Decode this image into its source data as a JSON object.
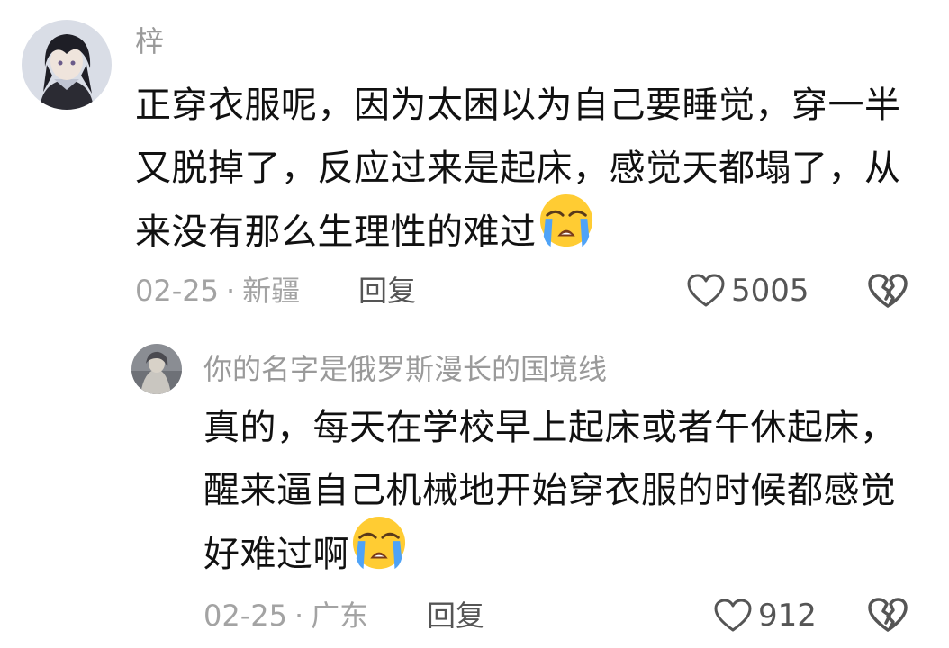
{
  "comments": [
    {
      "username": "梓",
      "body_lines": [
        "正穿衣服呢，因为太困以为自己要睡觉，穿一半",
        "又脱掉了，反应过来是起床，感觉天都塌了，从",
        "来没有那么生理性的难过"
      ],
      "date": "02-25",
      "location": "新疆",
      "reply_label": "回复",
      "like_count": "5005"
    },
    {
      "username": "你的名字是俄罗斯漫长的国境线",
      "body_lines": [
        "真的，每天在学校早上起床或者午休起床，",
        "醒来逼自己机械地开始穿衣服的时候都感觉",
        "好难过啊"
      ],
      "date": "02-25",
      "location": "广东",
      "reply_label": "回复",
      "like_count": "912"
    }
  ],
  "meta_separator": "·",
  "icons": {
    "like": "heart-outline-icon",
    "dislike": "broken-heart-icon",
    "emoji": "loudly-crying-face-emoji"
  },
  "colors": {
    "username": "#9a9a9a",
    "body_text": "#111111",
    "meta_text": "#a3a3a3",
    "action_text": "#555555"
  }
}
